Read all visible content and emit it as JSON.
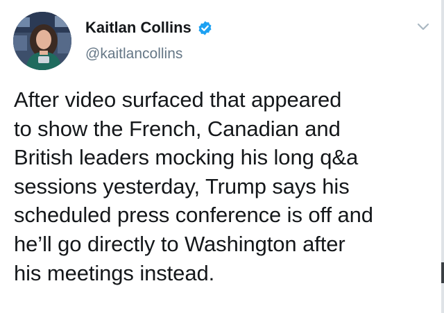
{
  "author": {
    "display_name": "Kaitlan Collins",
    "handle": "@kaitlancollins",
    "verified": true,
    "avatar_icon": "profile-photo"
  },
  "tweet": {
    "text": "After video surfaced that appeared\nto show the French, Canadian and\nBritish leaders mocking his long q&a\nsessions yesterday, Trump says his\nscheduled press conference is off and\nhe’ll go directly to Washington after\nhis meetings instead."
  },
  "colors": {
    "verified_badge": "#1da1f2",
    "handle_text": "#657786",
    "chevron": "#aab8c2",
    "body_text": "#14171a"
  },
  "icons": {
    "menu": "chevron-down-icon",
    "verified": "verified-badge-icon"
  }
}
